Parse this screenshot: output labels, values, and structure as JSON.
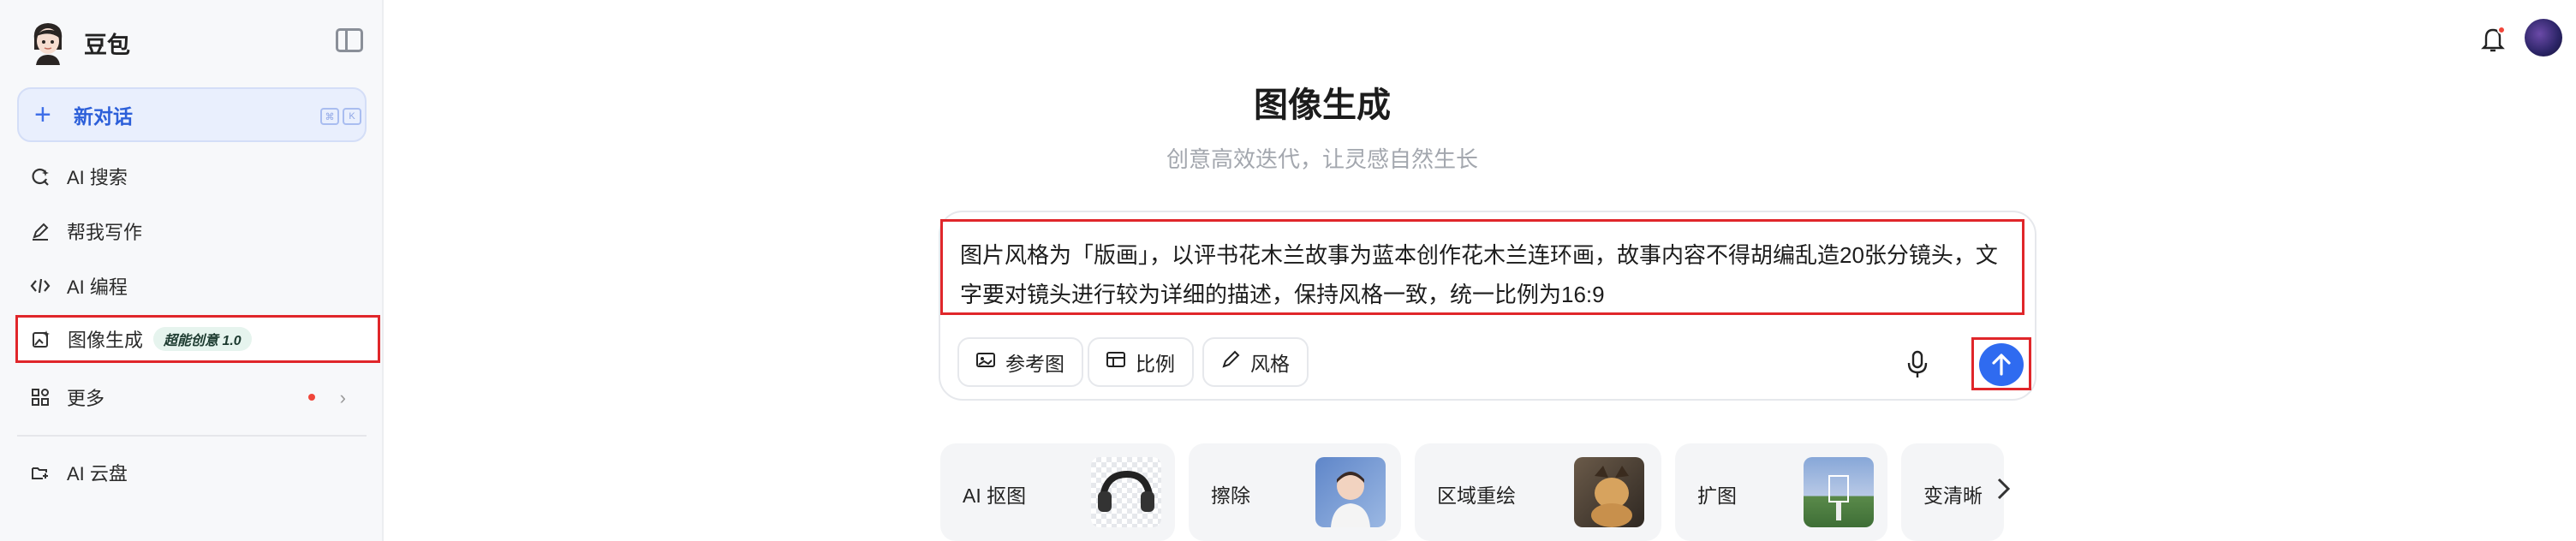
{
  "sidebar": {
    "brand_name": "豆包",
    "new_chat_label": "新对话",
    "shortcut_keys": [
      "⌘",
      "K"
    ],
    "items": [
      {
        "label": "AI 搜索",
        "icon": "search-icon"
      },
      {
        "label": "帮我写作",
        "icon": "pen-icon"
      },
      {
        "label": "AI 编程",
        "icon": "code-icon"
      },
      {
        "label": "图像生成",
        "icon": "image-gen-icon",
        "badge": "超能创意 1.0"
      },
      {
        "label": "更多",
        "icon": "apps-icon"
      },
      {
        "label": "AI 云盘",
        "icon": "cloud-drive-icon"
      }
    ]
  },
  "main": {
    "title": "图像生成",
    "subtitle": "创意高效迭代，让灵感自然生长",
    "prompt_text": "图片风格为「版画」，以评书花木兰故事为蓝本创作花木兰连环画，故事内容不得胡编乱造20张分镜头，文字要对镜头进行较为详细的描述，保持风格一致，统一比例为16:9",
    "tools": [
      {
        "label": "参考图",
        "icon": "reference-image-icon"
      },
      {
        "label": "比例",
        "icon": "aspect-ratio-icon"
      },
      {
        "label": "风格",
        "icon": "brush-icon"
      }
    ],
    "send_icon": "arrow-up-icon",
    "cards": [
      {
        "label": "AI 抠图"
      },
      {
        "label": "擦除"
      },
      {
        "label": "区域重绘"
      },
      {
        "label": "扩图"
      },
      {
        "label": "变清晰"
      }
    ]
  },
  "colors": {
    "accent": "#2f6bf0",
    "highlight_frame": "#e0262a",
    "notification_dot": "#f0463a"
  }
}
